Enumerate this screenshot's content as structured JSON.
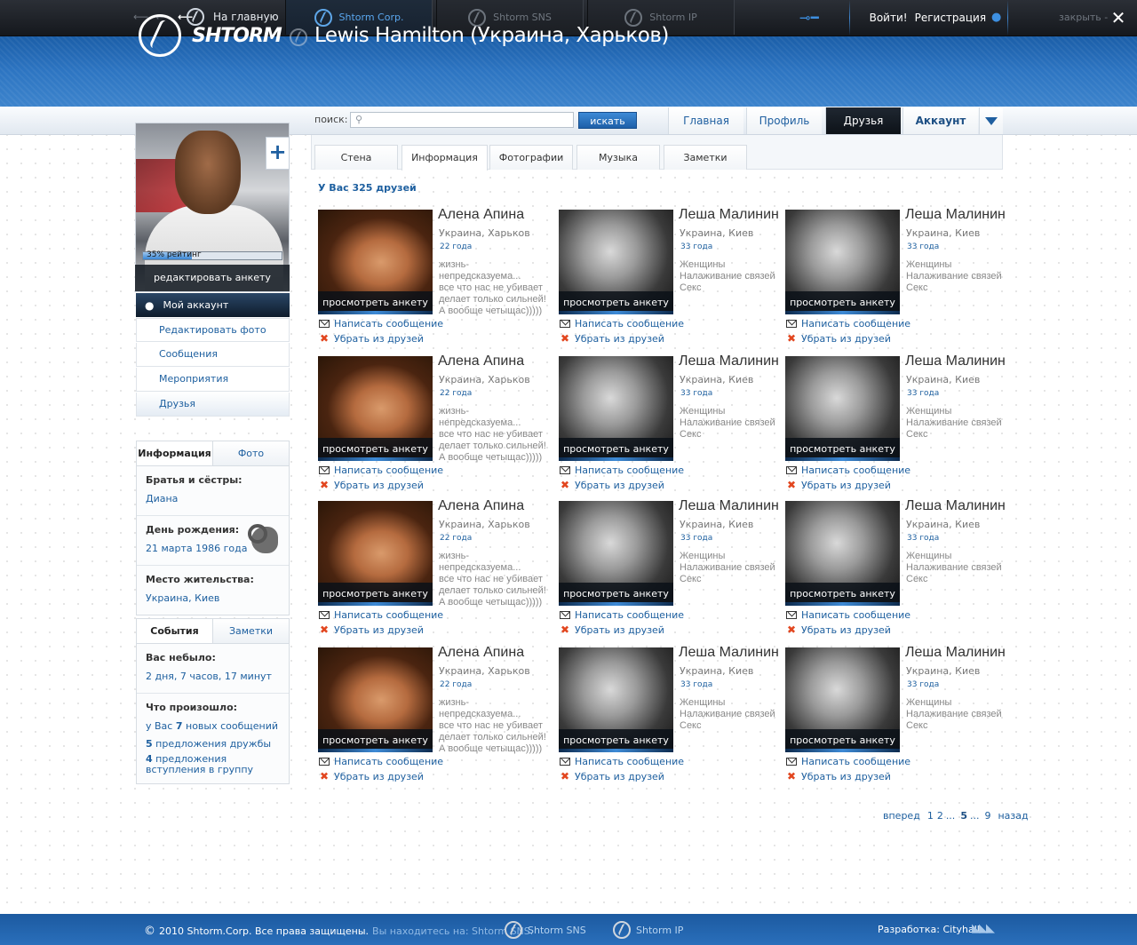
{
  "topbar": {
    "home_label": "На главную",
    "tabs": [
      {
        "label": "Shtorm Corp."
      },
      {
        "label": "Shtorm SNS"
      },
      {
        "label": "Shtorm IP"
      }
    ],
    "login_label": "Войти!",
    "register_label": "Регистрация",
    "close_label": "закрыть -",
    "accent_color": "#3d8fe0"
  },
  "header": {
    "brand": "SHTORM",
    "title": "Lewis Hamilton (Украина, Харьков)"
  },
  "search": {
    "label": "поиск:",
    "placeholder": "",
    "button_label": "искать"
  },
  "main_nav": {
    "items": [
      {
        "label": "Главная"
      },
      {
        "label": "Профиль"
      },
      {
        "label": "Друзья"
      },
      {
        "label": "Аккаунт"
      }
    ],
    "active": "Друзья"
  },
  "profile": {
    "rating_label": "35% рейтинг",
    "rating_fraction": 0.35,
    "edit_label": "редактировать анкету",
    "add_label": "+"
  },
  "sidebar": {
    "my_account": "Мой аккаунт",
    "links": [
      {
        "label": "Редактировать фото"
      },
      {
        "label": "Сообщения"
      },
      {
        "label": "Мероприятия"
      },
      {
        "label": "Друзья"
      }
    ]
  },
  "info_box": {
    "tabs": [
      {
        "label": "Информация"
      },
      {
        "label": "Фото"
      }
    ],
    "sections": [
      {
        "heading": "Братья и сёстры:",
        "value": "Диана"
      },
      {
        "heading": "День рождения:",
        "value": "21 марта 1986 года"
      },
      {
        "heading": "Место жительства:",
        "value": "Украина, Киев"
      }
    ]
  },
  "events_box": {
    "tabs": [
      {
        "label": "События"
      },
      {
        "label": "Заметки"
      }
    ],
    "absent_heading": "Вас небыло:",
    "absent_value": "2 дня, 7 часов, 17 минут",
    "happened_heading": "Что произошло:",
    "msg_pre": "у Вас",
    "msg_count": "7",
    "msg_post": "новых сообщений",
    "friend_count": "5",
    "friend_post": "предложения дружбы",
    "group_count": "4",
    "group_post": "предложения вступления в группу"
  },
  "content_tabs": [
    {
      "label": "Стена"
    },
    {
      "label": "Информация"
    },
    {
      "label": "Фотографии"
    },
    {
      "label": "Музыка"
    },
    {
      "label": "Заметки"
    }
  ],
  "friends_count_label": "У Вас 325 друзей",
  "friend_actions": {
    "view": "просмотреть анкету",
    "message": "Написать сообщение",
    "remove": "Убрать из друзей"
  },
  "friends": [
    {
      "name": "Алена Апина",
      "location": "Украина, Харьков",
      "age": "22 года",
      "desc": "жизнь-непредсказуема...\nвсе что нас не убивает\nделает только сильней!\nА вообще четыщас)))))",
      "photo": "female"
    },
    {
      "name": "Леша Малинин",
      "location": "Украина, Киев",
      "age": "33 года",
      "desc": "Женщины\nНалаживание связей\nСекс",
      "photo": "male"
    },
    {
      "name": "Леша Малинин",
      "location": "Украина, Киев",
      "age": "33 года",
      "desc": "Женщины\nНалаживание связей\nСекс",
      "photo": "male"
    },
    {
      "name": "Алена Апина",
      "location": "Украина, Харьков",
      "age": "22 года",
      "desc": "жизнь-непредсказуема...\nвсе что нас не убивает\nделает только сильней!\nА вообще четыщас)))))",
      "photo": "female"
    },
    {
      "name": "Леша Малинин",
      "location": "Украина, Киев",
      "age": "33 года",
      "desc": "Женщины\nНалаживание связей\nСекс",
      "photo": "male"
    },
    {
      "name": "Леша Малинин",
      "location": "Украина, Киев",
      "age": "33 года",
      "desc": "Женщины\nНалаживание связей\nСекс",
      "photo": "male"
    },
    {
      "name": "Алена Апина",
      "location": "Украина, Харьков",
      "age": "22 года",
      "desc": "жизнь-непредсказуема...\nвсе что нас не убивает\nделает только сильней!\nА вообще четыщас)))))",
      "photo": "female"
    },
    {
      "name": "Леша Малинин",
      "location": "Украина, Киев",
      "age": "33 года",
      "desc": "Женщины\nНалаживание связей\nСекс",
      "photo": "male"
    },
    {
      "name": "Леша Малинин",
      "location": "Украина, Киев",
      "age": "33 года",
      "desc": "Женщины\nНалаживание связей\nСекс",
      "photo": "male"
    },
    {
      "name": "Алена Апина",
      "location": "Украина, Харьков",
      "age": "22 года",
      "desc": "жизнь-непредсказуема...\nвсе что нас не убивает\nделает только сильней!\nА вообще четыщас)))))",
      "photo": "female"
    },
    {
      "name": "Леша Малинин",
      "location": "Украина, Киев",
      "age": "33 года",
      "desc": "Женщины\nНалаживание связей\nСекс",
      "photo": "male"
    },
    {
      "name": "Леша Малинин",
      "location": "Украина, Киев",
      "age": "33 года",
      "desc": "Женщины\nНалаживание связей\nСекс",
      "photo": "male"
    }
  ],
  "pager": {
    "next": "вперед",
    "pages": [
      "1",
      "2",
      "...",
      "5",
      "...",
      "9"
    ],
    "current": "5",
    "prev": "назад"
  },
  "footer": {
    "copyright": "2010 Shtorm.Corp. Все права защищены.",
    "location_prefix": "Вы находитесь на: Shtorm SNS.",
    "links": [
      {
        "label": "Shtorm SNS"
      },
      {
        "label": "Shtorm IP"
      }
    ],
    "developer": "Разработка: Cityhall"
  }
}
